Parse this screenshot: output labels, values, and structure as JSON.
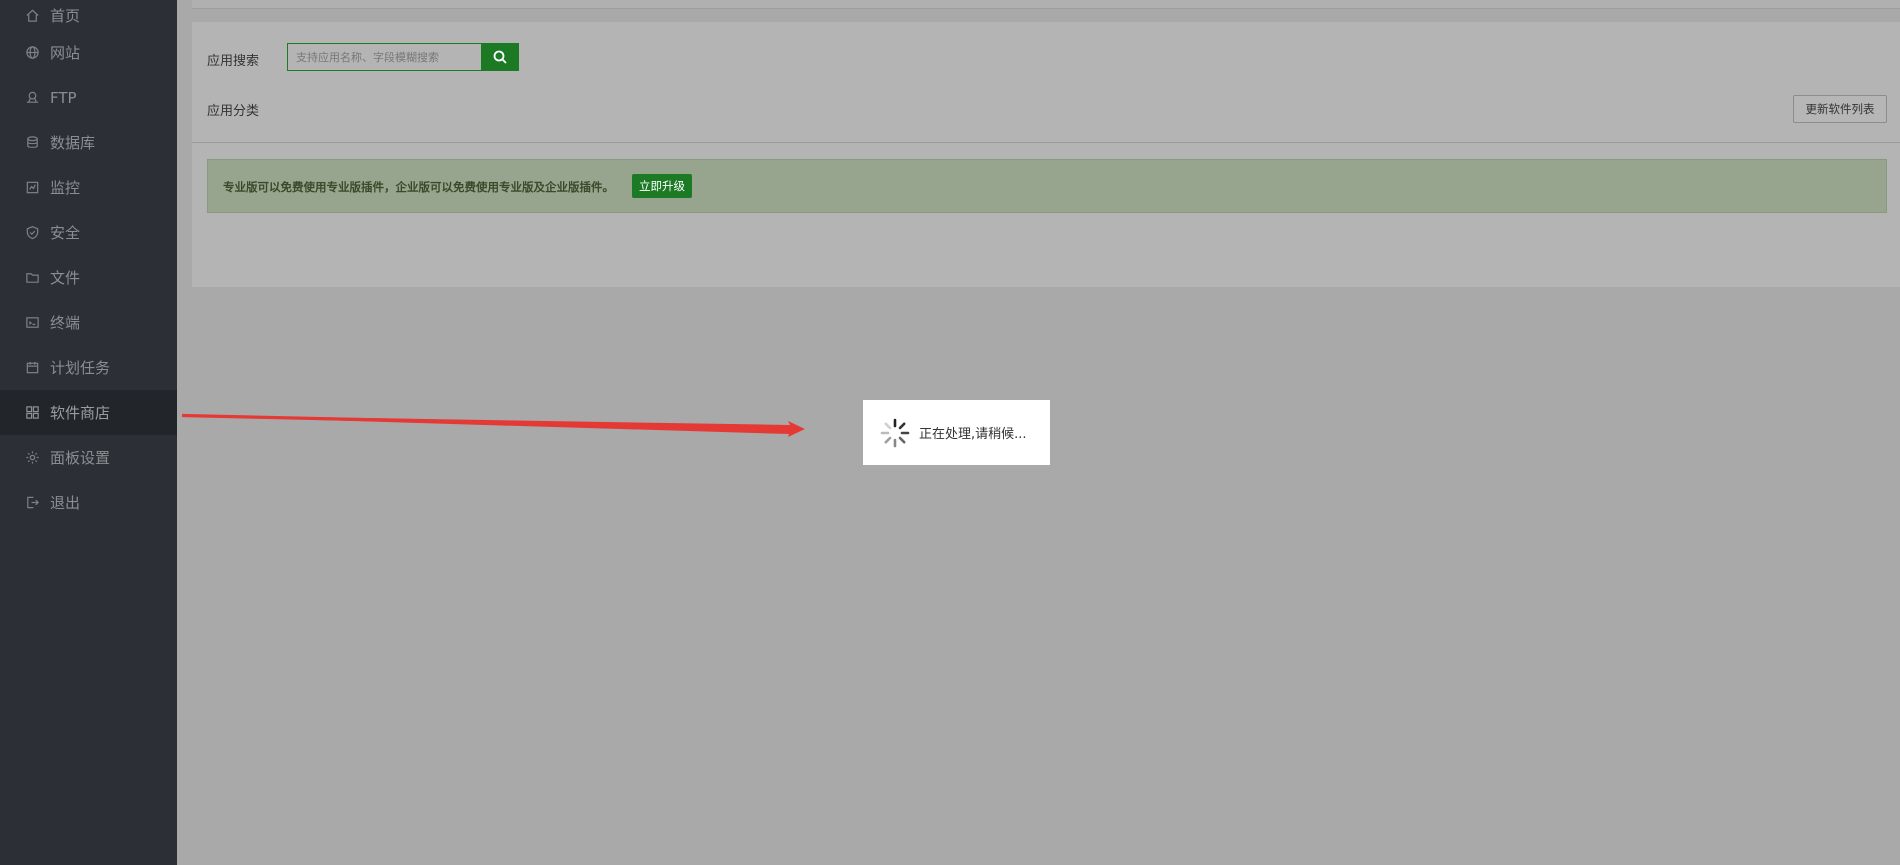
{
  "sidebar": {
    "items": [
      {
        "label": "首页",
        "icon": "home-icon"
      },
      {
        "label": "网站",
        "icon": "globe-icon"
      },
      {
        "label": "FTP",
        "icon": "ftp-icon"
      },
      {
        "label": "数据库",
        "icon": "database-icon"
      },
      {
        "label": "监控",
        "icon": "monitor-icon"
      },
      {
        "label": "安全",
        "icon": "shield-icon"
      },
      {
        "label": "文件",
        "icon": "folder-icon"
      },
      {
        "label": "终端",
        "icon": "terminal-icon"
      },
      {
        "label": "计划任务",
        "icon": "calendar-icon"
      },
      {
        "label": "软件商店",
        "icon": "grid-icon",
        "active": true
      },
      {
        "label": "面板设置",
        "icon": "gear-icon"
      },
      {
        "label": "退出",
        "icon": "logout-icon"
      }
    ]
  },
  "main": {
    "search_label": "应用搜索",
    "search_placeholder": "支持应用名称、字段模糊搜索",
    "category_label": "应用分类",
    "update_button": "更新软件列表",
    "notice_text": "专业版可以免费使用专业版插件，企业版可以免费使用专业版及企业版插件。",
    "upgrade_button": "立即升级"
  },
  "loading": {
    "text": "正在处理,请稍候..."
  },
  "colors": {
    "sidebar_bg": "#2c3036",
    "accent_green": "#1c7a24",
    "arrow_red": "#e53935"
  }
}
